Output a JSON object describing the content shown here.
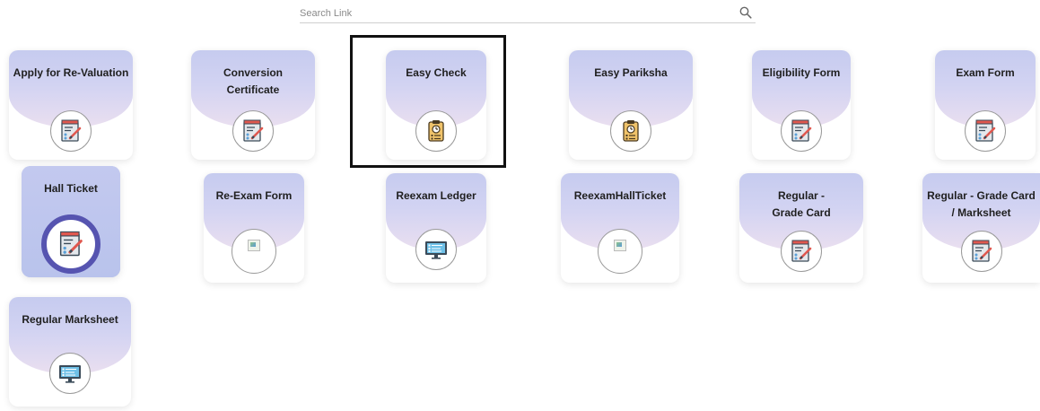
{
  "search": {
    "placeholder": "Search Link",
    "icon": "search-icon"
  },
  "cards": [
    {
      "label": "Apply for Re-Valuation",
      "icon": "form-edit-icon"
    },
    {
      "label": "Conversion Certificate",
      "icon": "form-edit-icon"
    },
    {
      "label": "Easy Check",
      "icon": "clipboard-clock-icon"
    },
    {
      "label": "Easy Pariksha",
      "icon": "clipboard-clock-icon"
    },
    {
      "label": "Eligibility Form",
      "icon": "form-edit-icon"
    },
    {
      "label": "Exam Form",
      "icon": "form-edit-icon"
    },
    {
      "label": "Hall Ticket",
      "icon": "form-edit-icon"
    },
    {
      "label": "Re-Exam Form",
      "icon": "broken-image-icon"
    },
    {
      "label": "Reexam Ledger",
      "icon": "monitor-list-icon"
    },
    {
      "label": "ReexamHallTicket",
      "icon": "broken-image-icon"
    },
    {
      "label": "Regular - Grade Card",
      "icon": "form-edit-icon"
    },
    {
      "label": "Regular - Grade Card / Marksheet",
      "icon": "form-edit-icon"
    },
    {
      "label": "Regular Marksheet",
      "icon": "monitor-list-icon"
    }
  ],
  "colors": {
    "accent": "#5654b0",
    "card_gradient_top": "#c6cbef",
    "card_gradient_bottom": "#eadff0"
  }
}
